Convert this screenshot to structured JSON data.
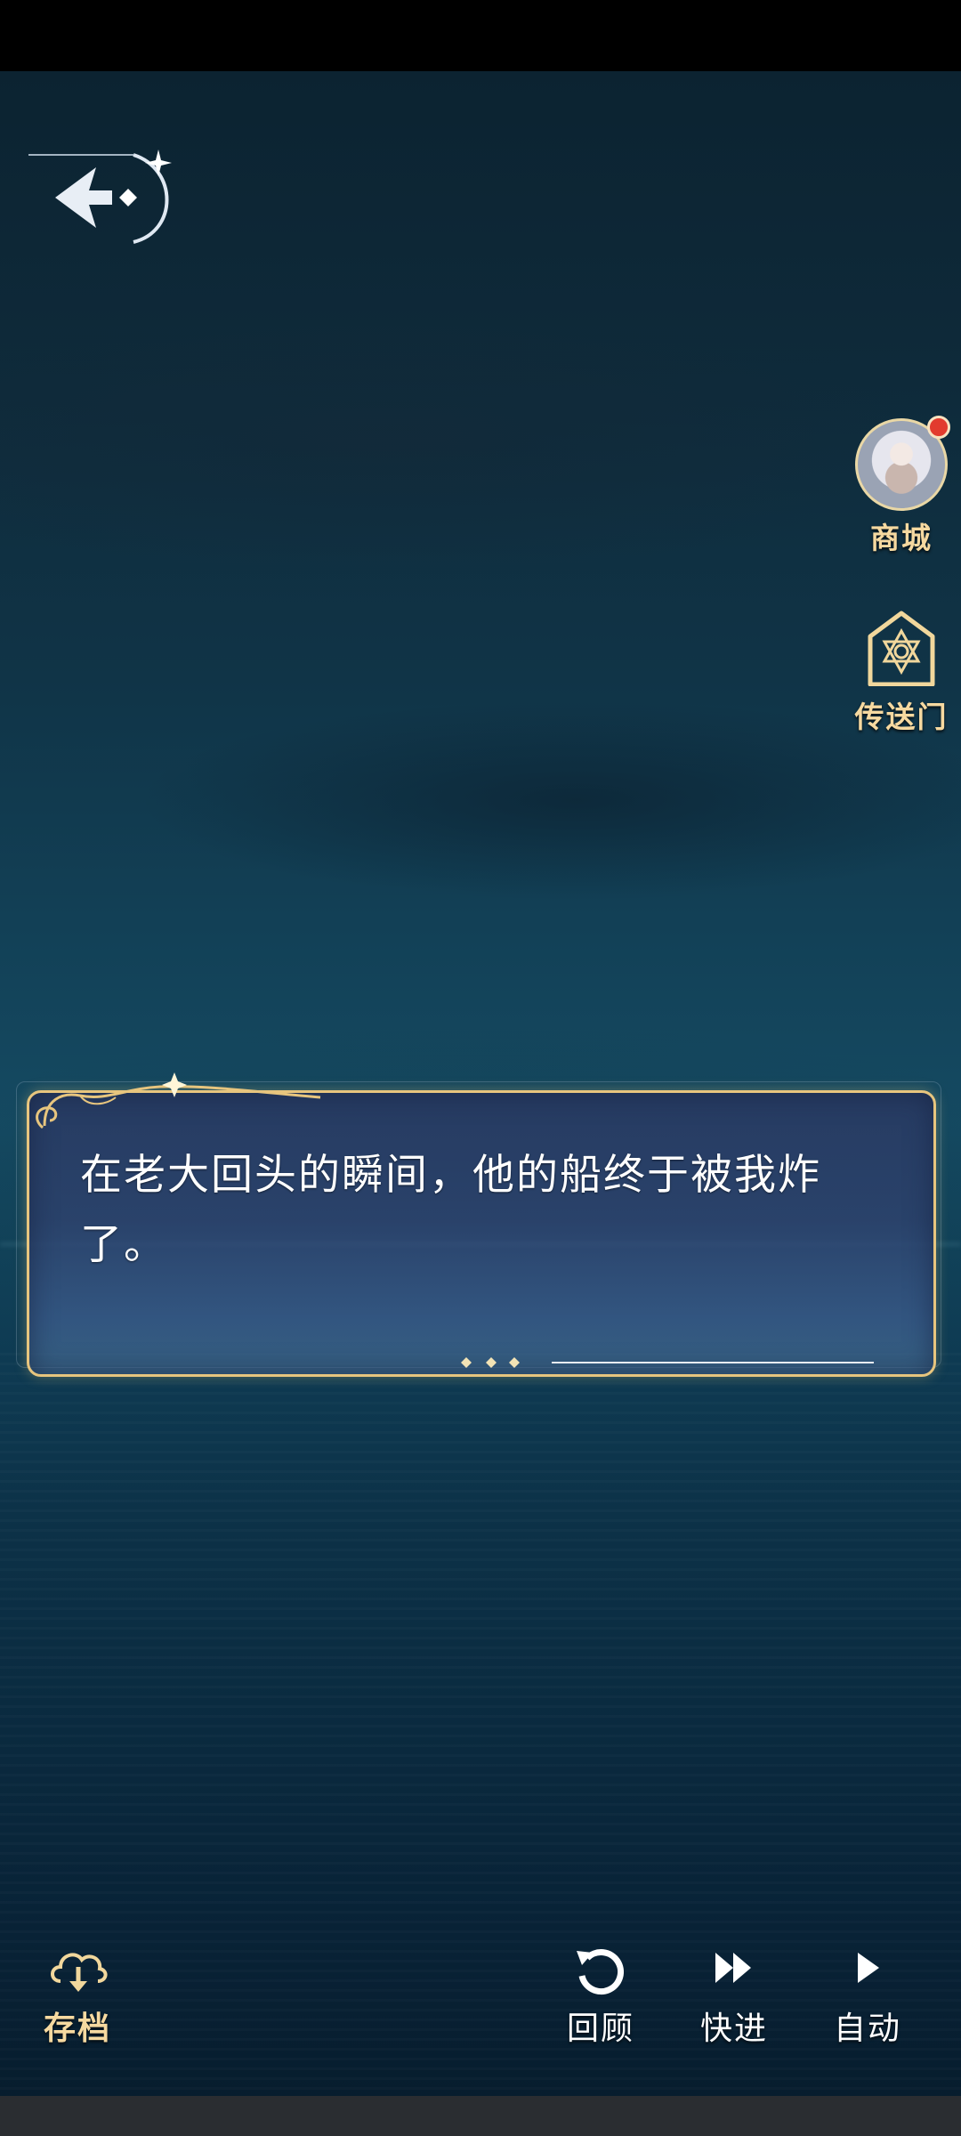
{
  "side_menu": {
    "shop_label": "商城",
    "portal_label": "传送门"
  },
  "dialog": {
    "text": "在老大回头的瞬间，他的船终于被我炸了。"
  },
  "controls": {
    "save_label": "存档",
    "review_label": "回顾",
    "fast_forward_label": "快进",
    "auto_label": "自动"
  },
  "icons": {
    "back": "back-arrow-icon",
    "shop": "character-avatar-icon",
    "portal": "hexagram-portal-icon",
    "save": "cloud-save-icon",
    "review": "rewind-circle-icon",
    "fast_forward": "fast-forward-icon",
    "auto": "play-icon"
  },
  "colors": {
    "gold_accent": "#e7c57e",
    "label_gold": "#f6d9a0",
    "notification": "#e23b2e",
    "sea_dark": "#0c2331"
  }
}
